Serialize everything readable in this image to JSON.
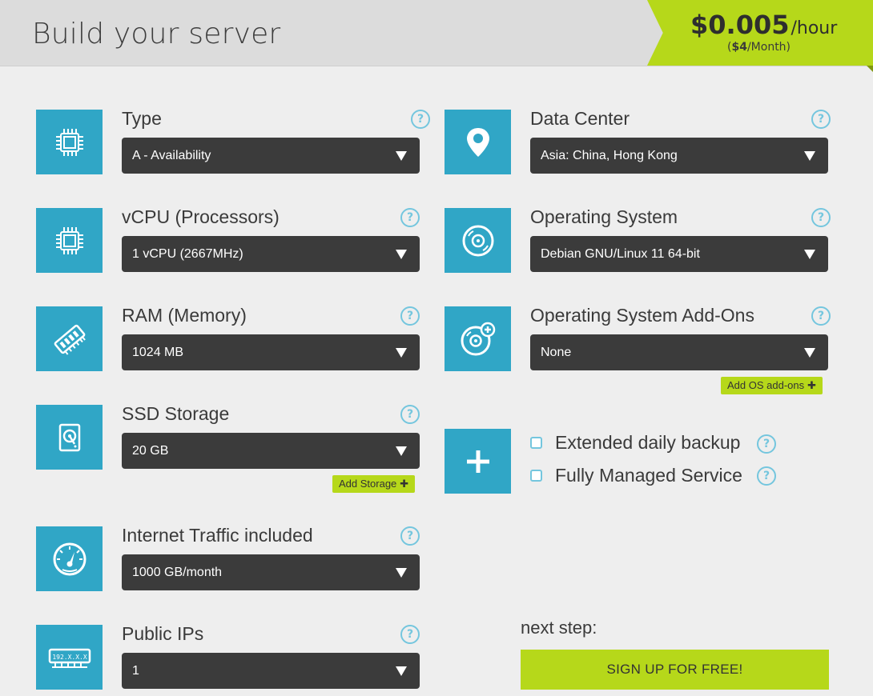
{
  "header": {
    "title": "Build your server",
    "price": {
      "amount": "$0.005",
      "unit": "/hour",
      "monthly_open": "(",
      "monthly_value": "$4",
      "monthly_rest": "/Month)"
    }
  },
  "fields": {
    "type": {
      "label": "Type",
      "value": "A - Availability",
      "icon": "chip-icon"
    },
    "vcpu": {
      "label": "vCPU (Processors)",
      "value": "1 vCPU (2667MHz)",
      "icon": "chip-icon"
    },
    "ram": {
      "label": "RAM (Memory)",
      "value": "1024 MB",
      "icon": "memory-icon"
    },
    "ssd": {
      "label": "SSD Storage",
      "value": "20 GB",
      "icon": "hard-drive-icon",
      "add_label": "Add Storage"
    },
    "traffic": {
      "label": "Internet Traffic included",
      "value": "1000 GB/month",
      "icon": "speedometer-icon"
    },
    "ips": {
      "label": "Public IPs",
      "value": "1",
      "icon": "ip-address-icon",
      "icon_text": "192.X.X.X"
    },
    "datacenter": {
      "label": "Data Center",
      "value": "Asia: China, Hong Kong",
      "icon": "location-pin-icon"
    },
    "os": {
      "label": "Operating System",
      "value": "Debian GNU/Linux 11 64-bit",
      "icon": "disc-icon"
    },
    "os_addons": {
      "label": "Operating System Add-Ons",
      "value": "None",
      "icon": "disc-plus-icon",
      "add_label": "Add OS add-ons"
    }
  },
  "extras": {
    "icon": "plus-icon",
    "options": [
      {
        "label": "Extended daily backup",
        "checked": false
      },
      {
        "label": "Fully Managed Service",
        "checked": false
      }
    ]
  },
  "next": {
    "label": "next step:",
    "button": "SIGN UP FOR FREE!"
  },
  "help_glyph": "?",
  "colors": {
    "accent_green": "#b6d81a",
    "icon_blue": "#30a6c6",
    "select_dark": "#3b3b3b",
    "help_blue": "#74c6de"
  }
}
